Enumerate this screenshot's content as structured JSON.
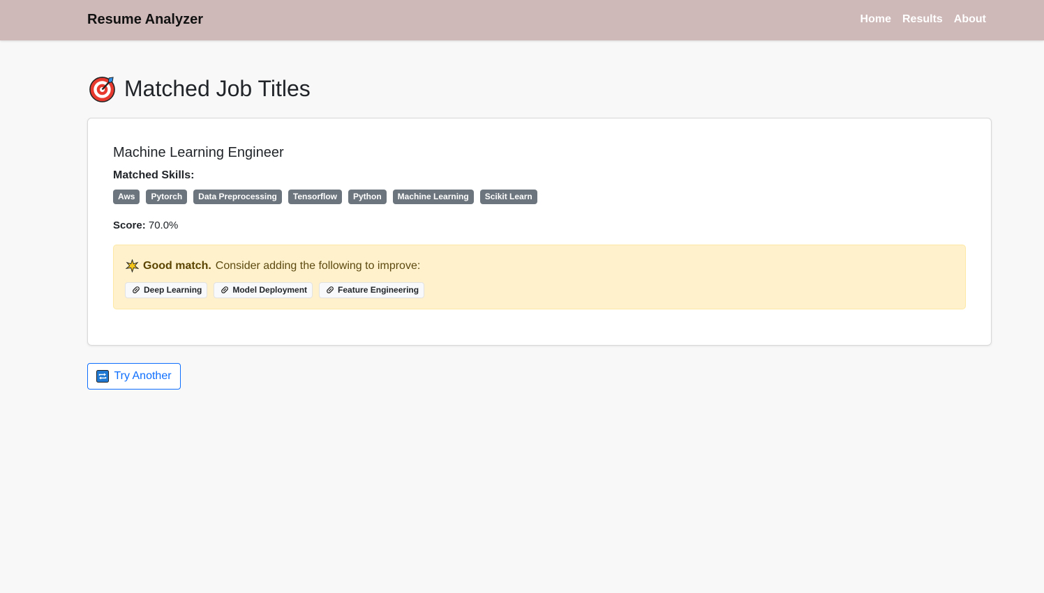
{
  "navbar": {
    "brand": "Resume Analyzer",
    "links": [
      "Home",
      "Results",
      "About"
    ]
  },
  "page": {
    "title": "Matched Job Titles",
    "title_icon": "target-icon"
  },
  "match": {
    "job_title": "Machine Learning Engineer",
    "skills_label": "Matched Skills:",
    "skills": [
      "Aws",
      "Pytorch",
      "Data Preprocessing",
      "Tensorflow",
      "Python",
      "Machine Learning",
      "Scikit Learn"
    ],
    "score_label": "Score:",
    "score_value": "70.0%",
    "alert": {
      "icon": "sparkle-icon",
      "strong": "Good match.",
      "text": "Consider adding the following to improve:",
      "suggestions": [
        "Deep Learning",
        "Model Deployment",
        "Feature Engineering"
      ],
      "suggestion_icon": "pill-icon"
    }
  },
  "actions": {
    "try_another": "Try Another",
    "try_another_icon": "repeat-icon"
  },
  "colors": {
    "navbar": "#cfb8b8",
    "badge": "#6c757d",
    "alert_bg": "#fff1cc",
    "primary": "#0d6efd"
  }
}
